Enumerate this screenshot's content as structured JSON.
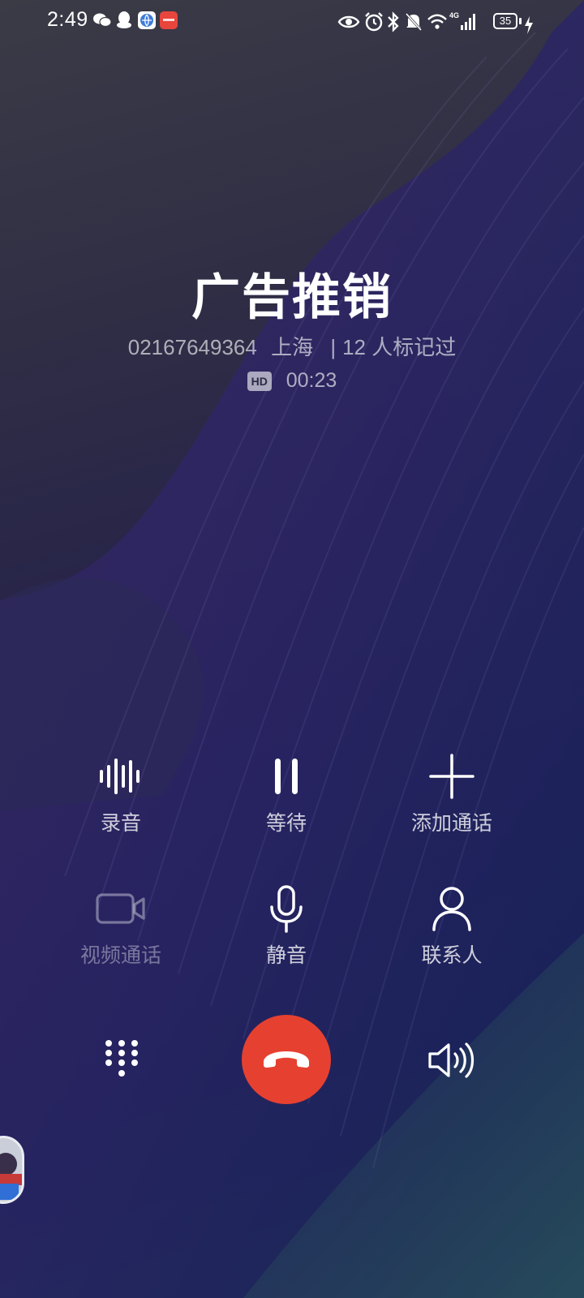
{
  "status_bar": {
    "time": "2:49",
    "notification_icons": [
      "wechat-icon",
      "qq-icon",
      "browser-icon",
      "huawei-app-icon"
    ],
    "system_icons": [
      "eye-comfort-icon",
      "alarm-icon",
      "bluetooth-icon",
      "mute-icon",
      "wifi-icon",
      "signal-4g-icon"
    ],
    "network": "4G",
    "battery": "35",
    "charging": true
  },
  "call": {
    "caller_name": "广告推销",
    "number": "02167649364",
    "location": "上海",
    "tag_info": "12 人标记过",
    "hd_label": "HD",
    "duration": "00:23"
  },
  "controls": {
    "record": "录音",
    "hold": "等待",
    "add_call": "添加通话",
    "video_call": "视频通话",
    "mute": "静音",
    "contacts": "联系人"
  },
  "colors": {
    "end_call": "#e64130",
    "background_top": "#3b3b46",
    "background_bottom": "#123448"
  }
}
